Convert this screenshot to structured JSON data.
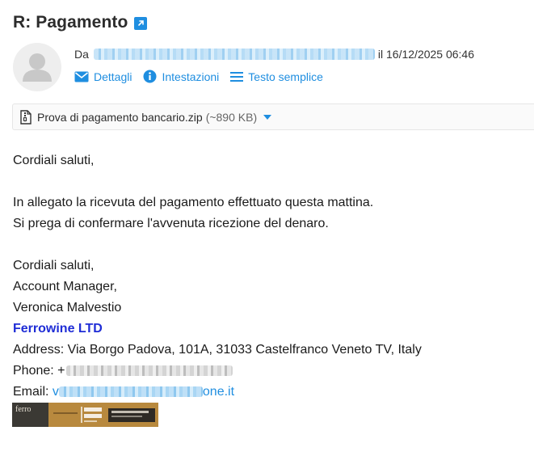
{
  "subject": "R: Pagamento",
  "header": {
    "from_label": "Da",
    "date_text": "il 16/12/2025 06:46",
    "actions": [
      {
        "label": "Dettagli",
        "icon": "envelope-icon"
      },
      {
        "label": "Intestazioni",
        "icon": "info-icon"
      },
      {
        "label": "Testo semplice",
        "icon": "lines-icon"
      }
    ]
  },
  "attachment": {
    "name": "Prova di pagamento bancario.zip",
    "size": "(~890 KB)"
  },
  "message": {
    "greeting": "Cordiali saluti,",
    "line1": "In allegato la ricevuta del pagamento effettuato questa mattina.",
    "line2": "Si prega di confermare l'avvenuta ricezione del denaro.",
    "closing": "Cordiali saluti,",
    "role": "Account Manager,",
    "name": "Veronica Malvestio",
    "company": "Ferrowine LTD",
    "address": "Address: Via Borgo Padova, 101A, 31033 Castelfranco Veneto TV, Italy",
    "phone_label": "Phone: +",
    "email_label": "Email: ",
    "email_prefix": "v",
    "email_suffix": "one.it"
  },
  "banner": {
    "logo_text": "ferro"
  },
  "colors": {
    "accent": "#1f8ee0",
    "company": "#1f2dd6"
  }
}
